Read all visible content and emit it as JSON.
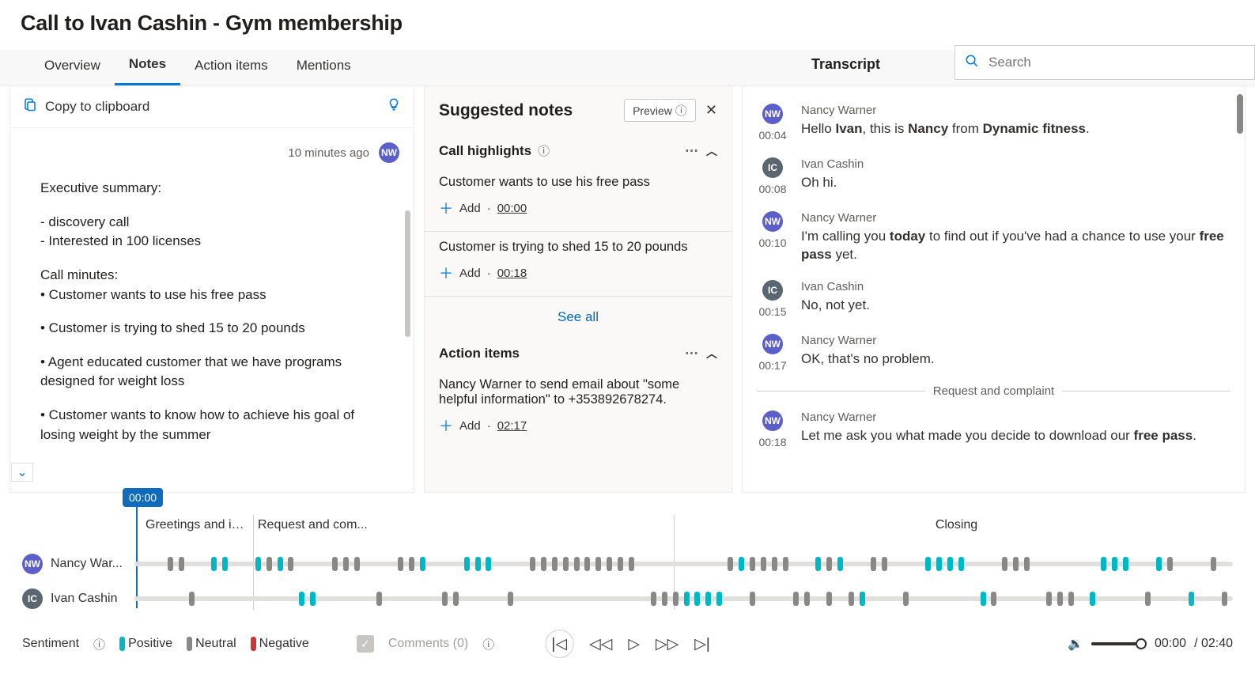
{
  "title": "Call to Ivan Cashin - Gym membership",
  "tabs": {
    "overview": "Overview",
    "notes": "Notes",
    "actionItems": "Action items",
    "mentions": "Mentions"
  },
  "transcriptHeading": "Transcript",
  "search": {
    "placeholder": "Search"
  },
  "notes": {
    "copy": "Copy to clipboard",
    "meta": "10 minutes ago",
    "avatar": "NW",
    "l1": "Executive summary:",
    "l2": "- discovery call",
    "l3": "- Interested in 100 licenses",
    "l4": "Call minutes:",
    "l5": "• Customer wants to use his free pass",
    "l6": "• Customer is trying to shed 15 to 20 pounds",
    "l7": "• Agent educated customer that we have programs designed for weight loss",
    "l8": "• Customer wants to know how to achieve his goal of losing weight by the summer"
  },
  "sugg": {
    "title": "Suggested notes",
    "preview": "Preview",
    "callHighlights": "Call highlights",
    "h1": "Customer wants to use his free pass",
    "h1t": "00:00",
    "h2": "Customer is trying to shed 15 to 20 pounds",
    "h2t": "00:18",
    "add": "Add",
    "seeAll": "See all",
    "actionItems": "Action items",
    "a1": "Nancy Warner to send email about \"some helpful information\" to +353892678274.",
    "a1t": "02:17"
  },
  "trans": {
    "r1n": "Nancy Warner",
    "r1t": "00:04",
    "r1a": "NW",
    "r1c": "nw",
    "r1x1": "Hello ",
    "r1x2": "Ivan",
    "r1x3": ", this is ",
    "r1x4": "Nancy",
    "r1x5": " from ",
    "r1x6": "Dynamic fitness",
    "r1x7": ".",
    "r2n": "Ivan Cashin",
    "r2t": "00:08",
    "r2a": "IC",
    "r2c": "ic",
    "r2x": "Oh hi.",
    "r3n": "Nancy Warner",
    "r3t": "00:10",
    "r3a": "NW",
    "r3c": "nw",
    "r3x1": "I'm calling you ",
    "r3x2": "today",
    "r3x3": " to find out if you've had a chance to use your ",
    "r3x4": "free pass",
    "r3x5": " yet.",
    "r4n": "Ivan Cashin",
    "r4t": "00:15",
    "r4a": "IC",
    "r4c": "ic",
    "r4x": "No, not yet.",
    "r5n": "Nancy Warner",
    "r5t": "00:17",
    "r5a": "NW",
    "r5c": "nw",
    "r5x": "OK, that's no problem.",
    "div": "Request and complaint",
    "r6n": "Nancy Warner",
    "r6t": "00:18",
    "r6a": "NW",
    "r6c": "nw",
    "r6x1": "Let me ask you what made you decide to download our ",
    "r6x2": "free pass",
    "r6x3": "."
  },
  "timeline": {
    "cursor": "00:00",
    "seg1": "Greetings and in...",
    "seg2": "Request and com...",
    "seg3": "Closing",
    "sp1": "Nancy War...",
    "sp1a": "NW",
    "sp2": "Ivan Cashin",
    "sp2a": "IC"
  },
  "playbar": {
    "sentiment": "Sentiment",
    "pos": "Positive",
    "neu": "Neutral",
    "neg": "Negative",
    "comments": "Comments (0)",
    "time": "00:00",
    "dur": "/ 02:40"
  }
}
